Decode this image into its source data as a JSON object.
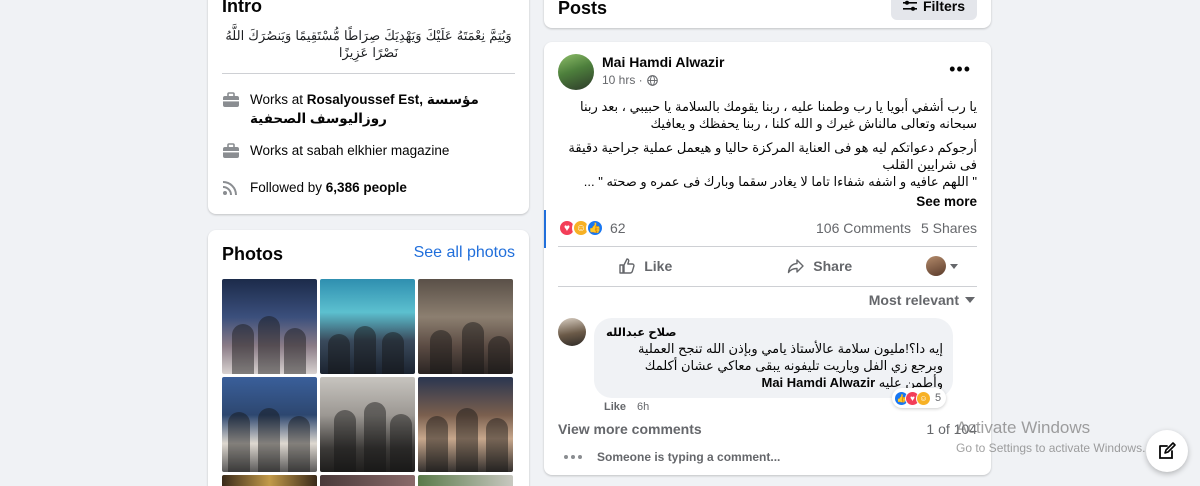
{
  "intro": {
    "title": "Intro",
    "bio": "وَيُتِمَّ نِعْمَتَهُ عَلَيْكَ وَيَهْدِيَكَ صِرَاطًا مُّسْتَقِيمًا وَيَنصُرَكَ اللَّهُ نَصْرًا عَزِيزًا",
    "work1_prefix": "Works at ",
    "work1_place": "Rosalyoussef Est, مؤسسة روزاليوسف الصحفية",
    "work2_prefix": "Works at ",
    "work2_place": "sabah elkhier magazine",
    "followed_prefix": "Followed by ",
    "followed_count": "6,386 people"
  },
  "photos": {
    "title": "Photos",
    "see_all": "See all photos"
  },
  "posts_header": {
    "title": "Posts",
    "filters_label": "Filters"
  },
  "post": {
    "author": "Mai Hamdi Alwazir",
    "time": "10 hrs ·",
    "audience_icon": "globe-icon",
    "paragraph1": "يا رب أشفي أبويا يا رب وطمنا عليه ، ربنا يقومك بالسلامة يا حبيبي ، بعد ربنا سبحانه وتعالى مالناش غيرك و الله كلنا ، ربنا يحفظك و يعافيك",
    "paragraph2": "أرجوكم دعواتكم ليه هو فى العناية المركزة حاليا و هيعمل عملية جراحية دقيقة فى شرايين القلب\n\" اللهم عافيه و اشفه شفاءا تاما لا يغادر سقما وبارك فى عمره و صحته \" ...",
    "see_more": "See more",
    "reactions_count": "62",
    "comments_count": "106 Comments",
    "shares_count": "5 Shares",
    "like_label": "Like",
    "share_label": "Share",
    "sort_label": "Most relevant"
  },
  "comment": {
    "author": "صلاح عبدالله",
    "text": "إيه دا؟!مليون سلامة عالأستاذ يامي وبإذن الله تنجح العملية وبرجع زي الفل وياريت تليفونه يبقى معاكي عشان أكلمك وأطمن عليه",
    "mention": "Mai Hamdi Alwazir",
    "like_label": "Like",
    "time": "6h",
    "reactions_count": "5"
  },
  "comments_footer": {
    "view_more": "View more comments",
    "pager": "1 of 104",
    "typing": "Someone is typing a comment..."
  },
  "watermark": {
    "title": "Activate Windows",
    "subtitle": "Go to Settings to activate Windows."
  },
  "colors": {
    "background": "#f0f2f5",
    "link_blue": "#216fdb",
    "secondary_text": "#65676b",
    "love": "#f33e58",
    "care": "#f7b125",
    "like": "#1877f2"
  }
}
